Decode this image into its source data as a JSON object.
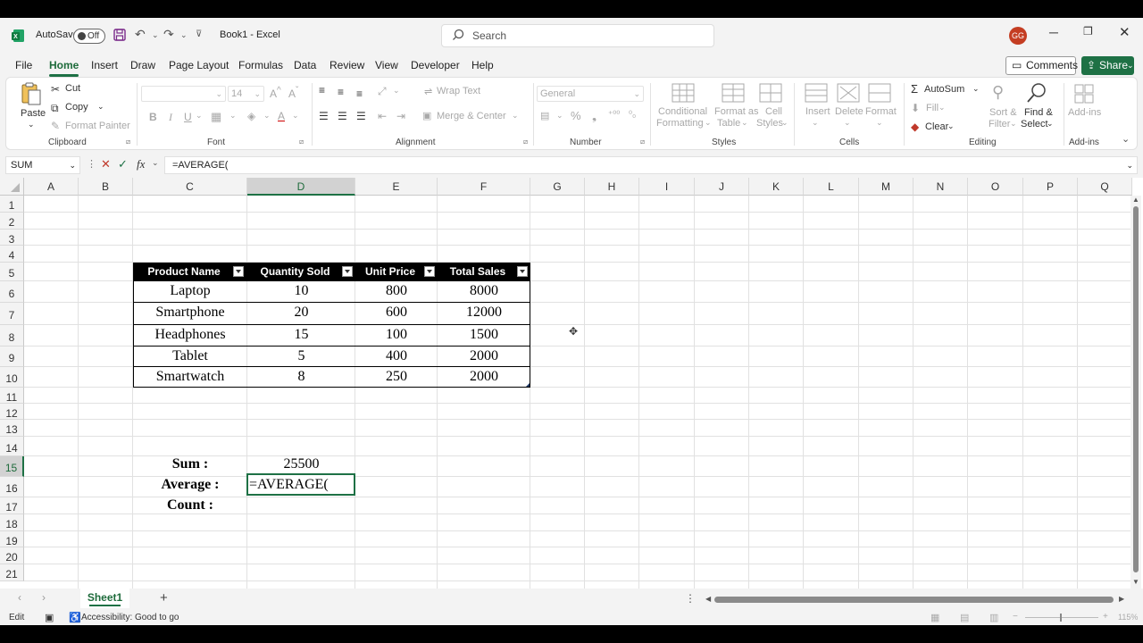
{
  "titlebar": {
    "autosave_label": "AutoSave",
    "autosave_state": "Off",
    "doc_title": "Book1  -  Excel",
    "search_placeholder": "Search",
    "user_initials": "GG",
    "brand_color": "#1e7145"
  },
  "menu": {
    "tabs": [
      "File",
      "Home",
      "Insert",
      "Draw",
      "Page Layout",
      "Formulas",
      "Data",
      "Review",
      "View",
      "Developer",
      "Help"
    ],
    "active": "Home",
    "comments_label": "Comments",
    "share_label": "Share"
  },
  "ribbon": {
    "clipboard": {
      "paste": "Paste",
      "cut": "Cut",
      "copy": "Copy",
      "format_painter": "Format Painter",
      "label": "Clipboard"
    },
    "font": {
      "size": "14",
      "label": "Font"
    },
    "alignment": {
      "wrap_text": "Wrap Text",
      "merge_center": "Merge & Center",
      "label": "Alignment"
    },
    "number": {
      "format": "General",
      "label": "Number"
    },
    "styles": {
      "conditional_1": "Conditional",
      "conditional_2": "Formatting",
      "format_table_1": "Format as",
      "format_table_2": "Table",
      "cell_styles_1": "Cell",
      "cell_styles_2": "Styles",
      "label": "Styles"
    },
    "cells": {
      "insert": "Insert",
      "delete": "Delete",
      "format": "Format",
      "label": "Cells"
    },
    "editing": {
      "autosum": "AutoSum",
      "fill": "Fill",
      "clear": "Clear",
      "sort_1": "Sort &",
      "sort_2": "Filter",
      "find_1": "Find &",
      "find_2": "Select",
      "label": "Editing"
    },
    "addins": {
      "label_btn": "Add-ins",
      "label": "Add-ins"
    }
  },
  "formula_bar": {
    "name_box": "SUM",
    "fx": "fx",
    "formula": "=AVERAGE("
  },
  "grid": {
    "columns": [
      "A",
      "B",
      "C",
      "D",
      "E",
      "F",
      "G",
      "H",
      "I",
      "J",
      "K",
      "L",
      "M",
      "N",
      "O",
      "P",
      "Q"
    ],
    "rows": [
      "1",
      "2",
      "3",
      "4",
      "5",
      "6",
      "7",
      "8",
      "9",
      "10",
      "11",
      "12",
      "13",
      "14",
      "15",
      "16",
      "17",
      "18",
      "19",
      "20",
      "21"
    ],
    "selected_column": "D",
    "selected_row": "15"
  },
  "table": {
    "headers": [
      "Product Name",
      "Quantity Sold",
      "Unit Price",
      "Total Sales"
    ],
    "rows": [
      [
        "Laptop",
        "10",
        "800",
        "8000"
      ],
      [
        "Smartphone",
        "20",
        "600",
        "12000"
      ],
      [
        "Headphones",
        "15",
        "100",
        "1500"
      ],
      [
        "Tablet",
        "5",
        "400",
        "2000"
      ],
      [
        "Smartwatch",
        "8",
        "250",
        "2000"
      ]
    ]
  },
  "summary": {
    "sum_label": "Sum :",
    "sum_value": "25500",
    "average_label": "Average :",
    "average_value": "=AVERAGE(",
    "count_label": "Count :"
  },
  "sheets": {
    "tabs": [
      "Sheet1"
    ],
    "add": "+"
  },
  "status": {
    "mode": "Edit",
    "accessibility": "Accessibility: Good to go",
    "zoom": "115%"
  }
}
